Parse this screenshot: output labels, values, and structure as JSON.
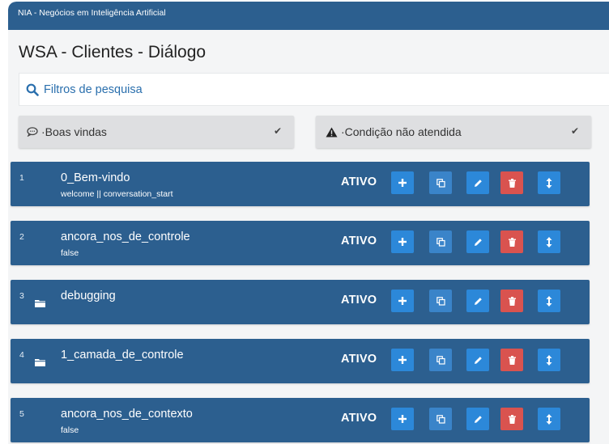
{
  "app": {
    "title": "NIA - Negócios em Inteligência Artificial"
  },
  "page": {
    "title": "WSA - Clientes - Diálogo"
  },
  "search": {
    "label": "Filtros de pesquisa"
  },
  "filters": {
    "left": {
      "label": "·Boas vindas",
      "icon": "chat-icon"
    },
    "right": {
      "label": "·Condição não atendida",
      "icon": "warning-icon"
    }
  },
  "rows": [
    {
      "num": "1",
      "name": "0_Bem-vindo",
      "sub": "welcome || conversation_start",
      "status": "ATIVO",
      "folder": false
    },
    {
      "num": "2",
      "name": "ancora_nos_de_controle",
      "sub": "false",
      "status": "ATIVO",
      "folder": false
    },
    {
      "num": "3",
      "name": "debugging",
      "sub": "",
      "status": "ATIVO",
      "folder": true
    },
    {
      "num": "4",
      "name": "1_camada_de_controle",
      "sub": "",
      "status": "ATIVO",
      "folder": true
    },
    {
      "num": "5",
      "name": "ancora_nos_de_contexto",
      "sub": "false",
      "status": "ATIVO",
      "folder": false
    }
  ],
  "colors": {
    "header": "#2c5f8f",
    "row": "#2c5f8f",
    "button": "#2c88d9",
    "delete": "#d9534f",
    "search_text": "#2a6fad"
  }
}
